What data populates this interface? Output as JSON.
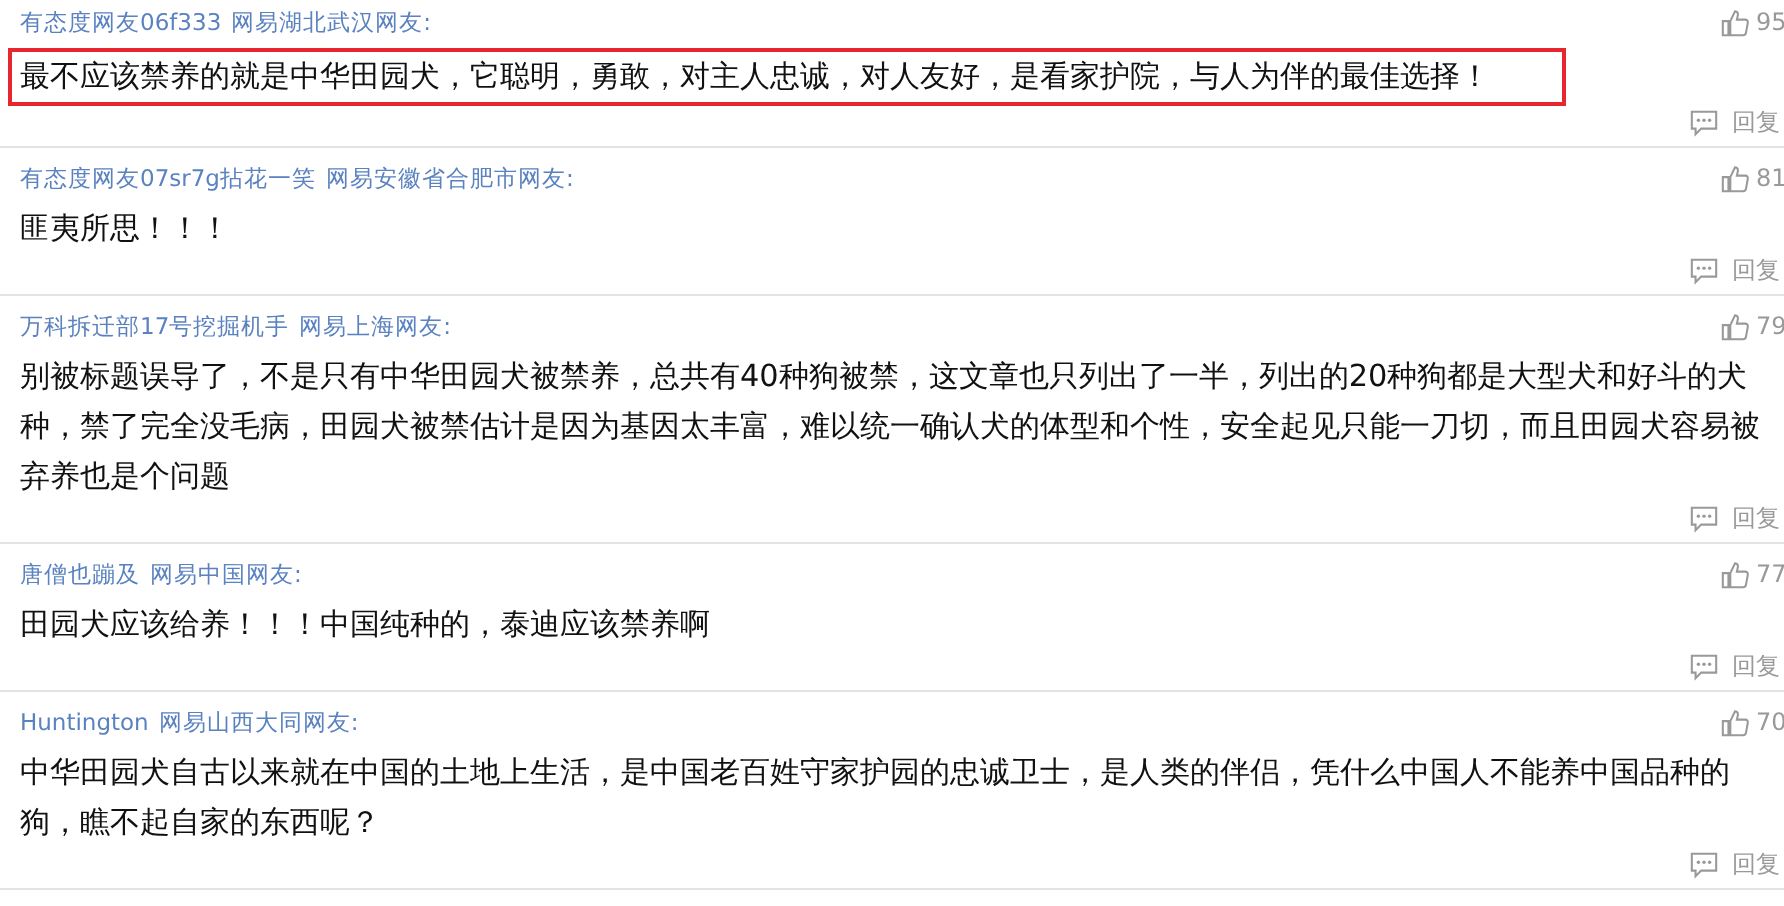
{
  "comments": [
    {
      "user": "有态度网友06f333",
      "location": "网易湖北武汉网友:",
      "likes": "95",
      "text": "最不应该禁养的就是中华田园犬，它聪明，勇敢，对主人忠诚，对人友好，是看家护院，与人为伴的最佳选择！",
      "highlighted": true,
      "reply": "回复"
    },
    {
      "user": "有态度网友07sr7g拈花一笑",
      "location": "网易安徽省合肥市网友:",
      "likes": "81",
      "text": "匪夷所思！！！",
      "highlighted": false,
      "reply": "回复"
    },
    {
      "user": "万科拆迁部17号挖掘机手",
      "location": "网易上海网友:",
      "likes": "79",
      "text": "别被标题误导了，不是只有中华田园犬被禁养，总共有40种狗被禁，这文章也只列出了一半，列出的20种狗都是大型犬和好斗的犬种，禁了完全没毛病，田园犬被禁估计是因为基因太丰富，难以统一确认犬的体型和个性，安全起见只能一刀切，而且田园犬容易被弃养也是个问题",
      "highlighted": false,
      "reply": "回复"
    },
    {
      "user": "唐僧也蹦及",
      "location": "网易中国网友:",
      "likes": "77",
      "text": "田园犬应该给养！！！中国纯种的，泰迪应该禁养啊",
      "highlighted": false,
      "reply": "回复"
    },
    {
      "user": "Huntington",
      "location": "网易山西大同网友:",
      "likes": "70",
      "text": "中华田园犬自古以来就在中国的土地上生活，是中国老百姓守家护园的忠诚卫士，是人类的伴侣，凭什么中国人不能养中国品种的狗，瞧不起自家的东西呢？",
      "highlighted": false,
      "reply": "回复"
    }
  ]
}
